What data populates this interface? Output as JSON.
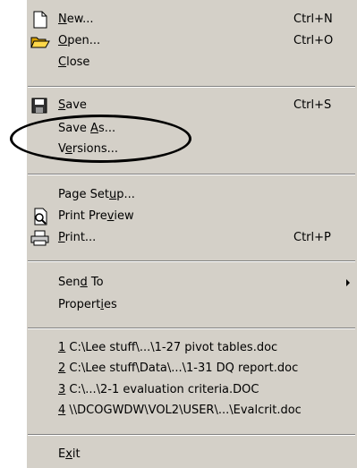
{
  "menu": {
    "items": [
      {
        "id": "new",
        "pre": "",
        "acc": "N",
        "post": "ew...",
        "shortcut": "Ctrl+N",
        "icon": "new-document-icon"
      },
      {
        "id": "open",
        "pre": "",
        "acc": "O",
        "post": "pen...",
        "shortcut": "Ctrl+O",
        "icon": "open-folder-icon"
      },
      {
        "id": "close",
        "pre": "",
        "acc": "C",
        "post": "lose",
        "shortcut": ""
      },
      {
        "id": "save",
        "pre": "",
        "acc": "S",
        "post": "ave",
        "shortcut": "Ctrl+S",
        "icon": "save-disk-icon"
      },
      {
        "id": "save-as",
        "pre": "Save ",
        "acc": "A",
        "post": "s...",
        "shortcut": ""
      },
      {
        "id": "versions",
        "pre": "V",
        "acc": "e",
        "post": "rsions...",
        "shortcut": ""
      },
      {
        "id": "page-setup",
        "pre": "Page Set",
        "acc": "u",
        "post": "p...",
        "shortcut": ""
      },
      {
        "id": "print-preview",
        "pre": "Print Pre",
        "acc": "v",
        "post": "iew",
        "shortcut": "",
        "icon": "print-preview-icon"
      },
      {
        "id": "print",
        "pre": "",
        "acc": "P",
        "post": "rint...",
        "shortcut": "Ctrl+P",
        "icon": "printer-icon"
      },
      {
        "id": "send-to",
        "pre": "Sen",
        "acc": "d",
        "post": " To",
        "shortcut": ""
      },
      {
        "id": "properties",
        "pre": "Propert",
        "acc": "i",
        "post": "es",
        "shortcut": ""
      },
      {
        "id": "recent-1",
        "pre": "",
        "acc": "1",
        "post": " C:\\Lee stuff\\...\\1-27 pivot tables.doc",
        "shortcut": ""
      },
      {
        "id": "recent-2",
        "pre": "",
        "acc": "2",
        "post": " C:\\Lee stuff\\Data\\...\\1-31 DQ report.doc",
        "shortcut": ""
      },
      {
        "id": "recent-3",
        "pre": "",
        "acc": "3",
        "post": " C:\\...\\2-1 evaluation criteria.DOC",
        "shortcut": ""
      },
      {
        "id": "recent-4",
        "pre": "",
        "acc": "4",
        "post": " \\\\DCOGWDW\\VOL2\\USER\\...\\Evalcrit.doc",
        "shortcut": ""
      },
      {
        "id": "exit",
        "pre": "E",
        "acc": "x",
        "post": "it",
        "shortcut": ""
      }
    ]
  }
}
